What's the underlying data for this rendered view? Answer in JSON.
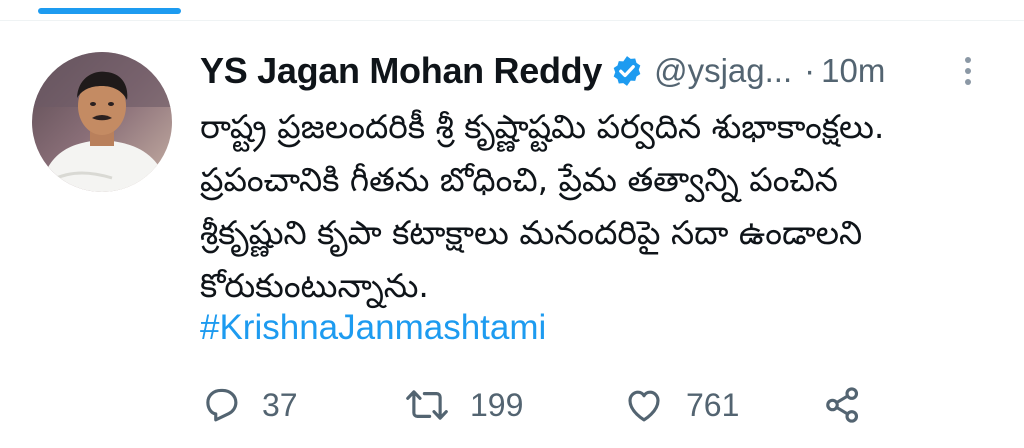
{
  "tweet": {
    "author_name": "YS Jagan Mohan Reddy",
    "handle": "@ysjag...",
    "separator": "·",
    "time": "10m",
    "text_lines": [
      "రాష్ట్ర ప్రజలందరికీ శ్రీ కృష్ణాష్టమి పర్వదిన శుభాకాంక్షలు.",
      "ప్రపంచానికి గీతను బోధించి, ప్రేమ తత్వాన్ని పంచిన",
      "శ్రీకృష్ణుని కృపా కటాక్షాలు మనందరిపై సదా ఉండాలని",
      "కోరుకుంటున్నాను."
    ],
    "hashtag": "#KrishnaJanmashtami",
    "reply_count": "37",
    "retweet_count": "199",
    "like_count": "761"
  },
  "icons": {
    "verified": "verified-badge-icon",
    "more": "more-vertical-icon",
    "reply": "reply-icon",
    "retweet": "retweet-icon",
    "like": "heart-icon",
    "share": "share-icon"
  },
  "colors": {
    "accent": "#1d9bf0",
    "text": "#0f1419",
    "secondary": "#536471"
  }
}
